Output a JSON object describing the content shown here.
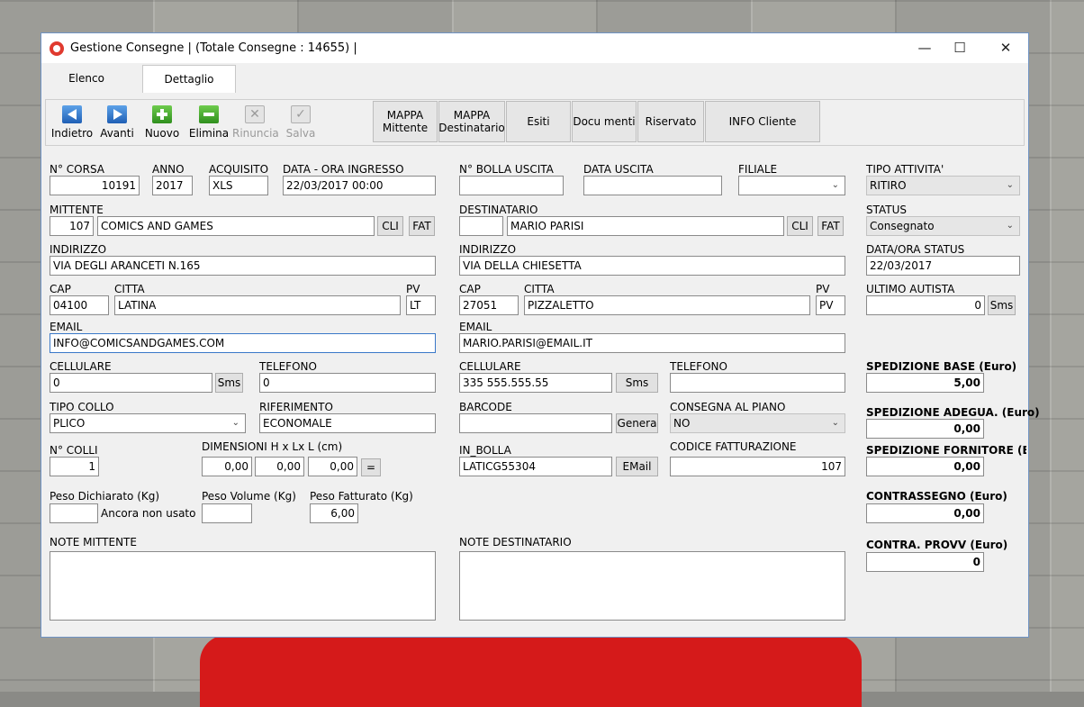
{
  "window": {
    "title": "Gestione Consegne | (Totale Consegne : 14655) |"
  },
  "window_controls": {
    "minimize": "—",
    "maximize": "☐",
    "close": "✕"
  },
  "tabs": [
    "Elenco",
    "Dettaglio"
  ],
  "toolbar": {
    "buttons": [
      "Indietro",
      "Avanti",
      "Nuovo",
      "Elimina",
      "Rinuncia",
      "Salva"
    ],
    "text_buttons": [
      "MAPPA Mittente",
      "MAPPA Destinatario",
      "Esiti",
      "Docu menti",
      "Riservato",
      "INFO Cliente"
    ]
  },
  "form": {
    "n_corsa": {
      "label": "N° CORSA",
      "value": "10191"
    },
    "anno": {
      "label": "ANNO",
      "value": "2017"
    },
    "acquisito": {
      "label": "ACQUISITO",
      "value": "XLS"
    },
    "data_ingresso": {
      "label": "DATA - ORA INGRESSO",
      "value": "22/03/2017 00:00"
    },
    "n_bolla_uscita": {
      "label": "N° BOLLA USCITA",
      "value": ""
    },
    "data_uscita": {
      "label": "DATA USCITA",
      "value": ""
    },
    "filiale": {
      "label": "FILIALE",
      "value": ""
    },
    "tipo_attivita": {
      "label": "TIPO ATTIVITA'",
      "value": "RITIRO"
    },
    "mittente": {
      "label": "MITTENTE",
      "code": "107",
      "name": "COMICS AND GAMES",
      "cli": "CLI",
      "fat": "FAT"
    },
    "destinatario": {
      "label": "DESTINATARIO",
      "code": "",
      "name": "MARIO PARISI",
      "cli": "CLI",
      "fat": "FAT"
    },
    "status": {
      "label": "STATUS",
      "value": "Consegnato"
    },
    "mitt_indirizzo": {
      "label": "INDIRIZZO",
      "value": "VIA DEGLI ARANCETI N.165"
    },
    "dest_indirizzo": {
      "label": "INDIRIZZO",
      "value": "VIA DELLA CHIESETTA"
    },
    "data_ora_status": {
      "label": "DATA/ORA STATUS",
      "value": "22/03/2017"
    },
    "mitt_cap": {
      "label": "CAP",
      "value": "04100"
    },
    "mitt_citta": {
      "label": "CITTA",
      "value": "LATINA"
    },
    "mitt_pv": {
      "label": "PV",
      "value": "LT"
    },
    "dest_cap": {
      "label": "CAP",
      "value": "27051"
    },
    "dest_citta": {
      "label": "CITTA",
      "value": "PIZZALETTO"
    },
    "dest_pv": {
      "label": "PV",
      "value": "PV"
    },
    "ultimo_autista": {
      "label": "ULTIMO AUTISTA",
      "value": "0",
      "sms": "Sms"
    },
    "mitt_email": {
      "label": "EMAIL",
      "value": "INFO@COMICSANDGAMES.COM"
    },
    "dest_email": {
      "label": "EMAIL",
      "value": "MARIO.PARISI@EMAIL.IT"
    },
    "mitt_cellulare": {
      "label": "CELLULARE",
      "value": "0",
      "sms": "Sms"
    },
    "mitt_telefono": {
      "label": "TELEFONO",
      "value": "0"
    },
    "dest_cellulare": {
      "label": "CELLULARE",
      "value": "335 555.555.55",
      "sms": "Sms"
    },
    "dest_telefono": {
      "label": "TELEFONO",
      "value": ""
    },
    "spedizione_base": {
      "label": "SPEDIZIONE BASE (Euro)",
      "value": "5,00"
    },
    "tipo_collo": {
      "label": "TIPO COLLO",
      "value": "PLICO"
    },
    "riferimento": {
      "label": "RIFERIMENTO",
      "value": "ECONOMALE"
    },
    "barcode": {
      "label": "BARCODE",
      "value": "",
      "button": "Genera"
    },
    "consegna_piano": {
      "label": "CONSEGNA AL PIANO",
      "value": "NO"
    },
    "spedizione_adegua": {
      "label": "SPEDIZIONE ADEGUA. (Euro)",
      "value": "0,00"
    },
    "n_colli": {
      "label": "N° COLLI",
      "value": "1"
    },
    "dimensioni": {
      "label": "DIMENSIONI H x Lx L (cm)",
      "h": "0,00",
      "l1": "0,00",
      "l2": "0,00",
      "button": "="
    },
    "in_bolla": {
      "label": "IN_BOLLA",
      "value": "LATICG55304",
      "button": "EMail"
    },
    "codice_fatturazione": {
      "label": "CODICE FATTURAZIONE",
      "value": "107"
    },
    "spedizione_fornitore": {
      "label": "SPEDIZIONE FORNITORE (Euro",
      "value": "0,00"
    },
    "peso_dichiarato": {
      "label": "Peso Dichiarato (Kg)",
      "value": "",
      "note": "Ancora non usato"
    },
    "peso_volume": {
      "label": "Peso Volume (Kg)",
      "value": ""
    },
    "peso_fatturato": {
      "label": "Peso Fatturato (Kg)",
      "value": "6,00"
    },
    "contrassegno": {
      "label": "CONTRASSEGNO (Euro)",
      "value": "0,00"
    },
    "note_mittente": {
      "label": "NOTE MITTENTE",
      "value": ""
    },
    "note_destinatario": {
      "label": "NOTE DESTINATARIO",
      "value": ""
    },
    "contra_provv": {
      "label": "CONTRA.  PROVV (Euro)",
      "value": "0"
    }
  }
}
